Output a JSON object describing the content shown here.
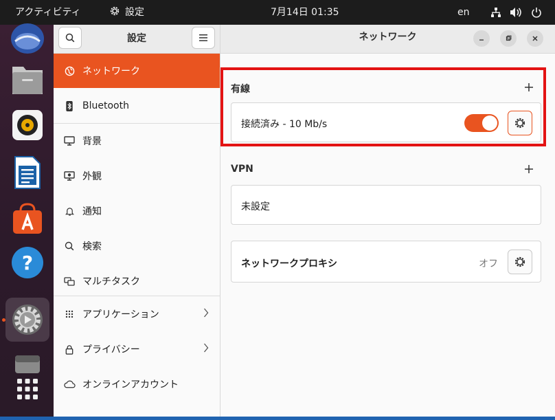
{
  "topbar": {
    "activities": "アクティビティ",
    "app_name": "設定",
    "clock": "7月14日  01:35",
    "input_method": "en",
    "tray_icons": [
      "network-wired-icon",
      "volume-icon",
      "power-icon"
    ]
  },
  "dock": {
    "apps": [
      "thunderbird-icon",
      "files-icon",
      "rhythmbox-icon",
      "libreoffice-writer-icon",
      "app-center-icon",
      "help-icon",
      "settings-icon",
      "disk-icon",
      "show-apps-icon"
    ],
    "active": "settings-icon"
  },
  "sidebar": {
    "title": "設定",
    "items": [
      {
        "label": "ネットワーク",
        "icon": "network-icon"
      },
      {
        "label": "Bluetooth",
        "icon": "bluetooth-icon"
      },
      {
        "label": "背景",
        "icon": "background-icon"
      },
      {
        "label": "外観",
        "icon": "appearance-icon"
      },
      {
        "label": "通知",
        "icon": "bell-icon"
      },
      {
        "label": "検索",
        "icon": "search-icon"
      },
      {
        "label": "マルチタスク",
        "icon": "multitask-icon"
      },
      {
        "label": "アプリケーション",
        "icon": "apps-grid-icon"
      },
      {
        "label": "プライバシー",
        "icon": "lock-icon"
      },
      {
        "label": "オンラインアカウント",
        "icon": "cloud-icon"
      }
    ]
  },
  "main": {
    "title": "ネットワーク",
    "wired": {
      "title": "有線",
      "status": "接続済み - 10 Mb/s",
      "enabled": true
    },
    "vpn": {
      "title": "VPN",
      "status": "未設定"
    },
    "proxy": {
      "label": "ネットワークプロキシ",
      "value": "オフ"
    }
  },
  "colors": {
    "accent": "#e95420",
    "highlight_box": "#e31313",
    "dock_bg": "#2c1a2a",
    "topbar_bg": "#1c1c1c"
  }
}
